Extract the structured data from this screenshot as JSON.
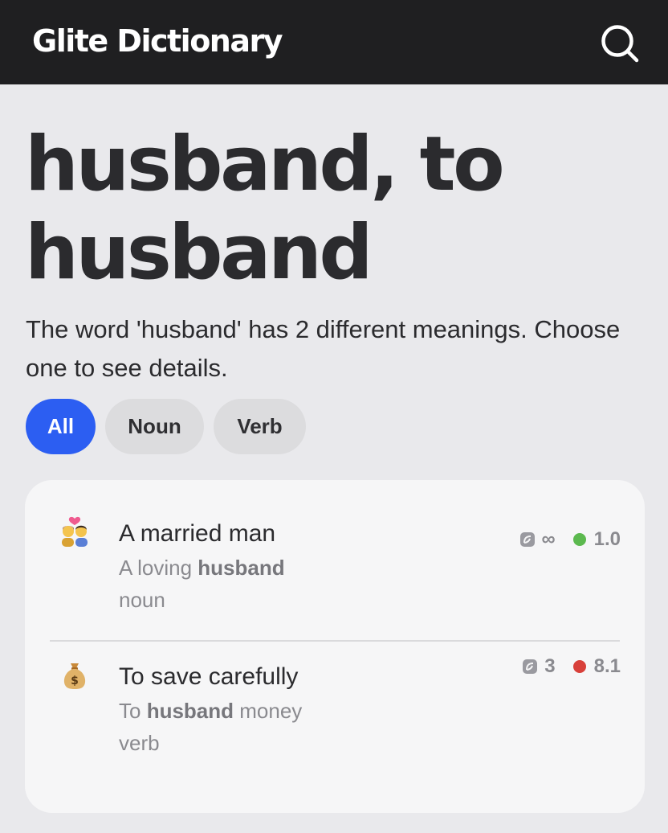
{
  "header": {
    "brand": "Glite Dictionary",
    "search_icon": "search-icon"
  },
  "page": {
    "title": "husband, to husband",
    "intro": "The word 'husband' has 2 different meanings. Choose one to see details."
  },
  "filters": [
    {
      "label": "All",
      "active": true
    },
    {
      "label": "Noun",
      "active": false
    },
    {
      "label": "Verb",
      "active": false
    }
  ],
  "entries": [
    {
      "emoji": "couple-with-heart-icon",
      "meaning": "A married man",
      "example_before": "A loving ",
      "example_word": "husband",
      "example_after": "",
      "pos": "noun",
      "count": "∞",
      "score": "1.0",
      "score_color": "#5cb94f"
    },
    {
      "emoji": "money-bag-icon",
      "meaning": "To save carefully",
      "example_before": "To ",
      "example_word": "husband",
      "example_after": " money",
      "pos": "verb",
      "count": "3",
      "score": "8.1",
      "score_color": "#d8403a"
    }
  ],
  "colors": {
    "topbar": "#1f1f21",
    "accent": "#2c5ef2",
    "background": "#e9e9ec",
    "card": "#f6f6f7"
  }
}
